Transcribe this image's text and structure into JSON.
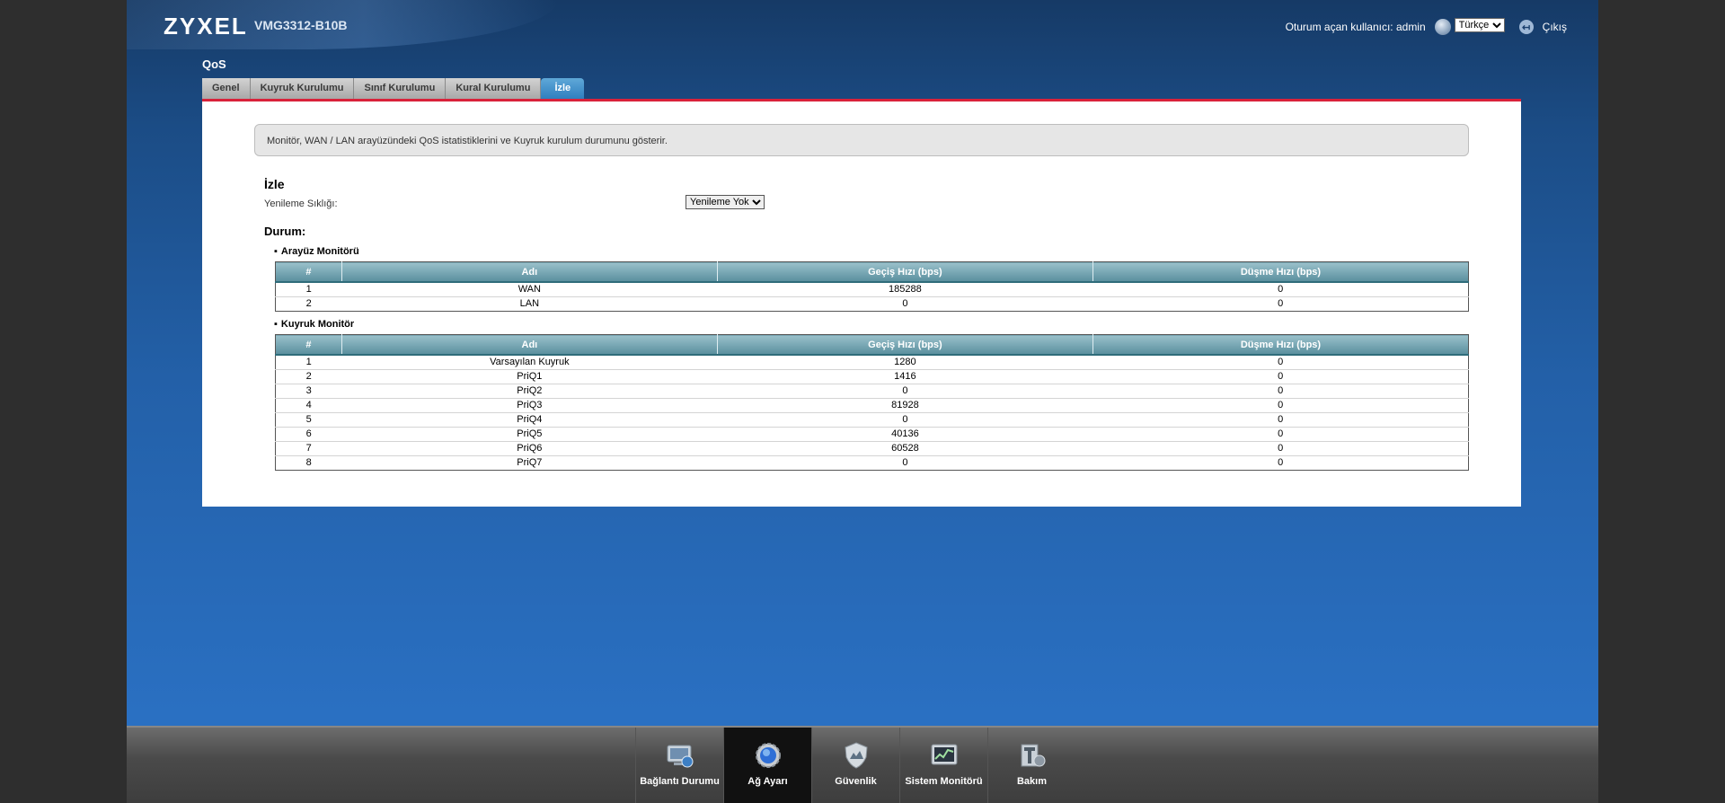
{
  "header": {
    "brand": "ZYXEL",
    "model": "VMG3312-B10B",
    "user_label": "Oturum açan kullanıcı: admin",
    "language": "Türkçe",
    "logout_label": "Çıkış"
  },
  "page": {
    "title": "QoS",
    "tabs": [
      {
        "label": "Genel",
        "active": false
      },
      {
        "label": "Kuyruk Kurulumu",
        "active": false
      },
      {
        "label": "Sınıf Kurulumu",
        "active": false
      },
      {
        "label": "Kural Kurulumu",
        "active": false
      },
      {
        "label": "İzle",
        "active": true
      }
    ]
  },
  "content": {
    "info": "Monitör, WAN / LAN arayüzündeki QoS istatistiklerini ve Kuyruk kurulum durumunu gösterir.",
    "section_title": "İzle",
    "refresh_label": "Yenileme Sıklığı:",
    "refresh_value": "Yenileme Yok",
    "status_title": "Durum:",
    "interface_monitor": {
      "title": "Arayüz Monitörü",
      "columns": [
        "#",
        "Adı",
        "Geçiş Hızı (bps)",
        "Düşme Hızı (bps)"
      ],
      "rows": [
        [
          "1",
          "WAN",
          "185288",
          "0"
        ],
        [
          "2",
          "LAN",
          "0",
          "0"
        ]
      ]
    },
    "queue_monitor": {
      "title": "Kuyruk Monitör",
      "columns": [
        "#",
        "Adı",
        "Geçiş Hızı (bps)",
        "Düşme Hızı (bps)"
      ],
      "rows": [
        [
          "1",
          "Varsayılan Kuyruk",
          "1280",
          "0"
        ],
        [
          "2",
          "PriQ1",
          "1416",
          "0"
        ],
        [
          "3",
          "PriQ2",
          "0",
          "0"
        ],
        [
          "4",
          "PriQ3",
          "81928",
          "0"
        ],
        [
          "5",
          "PriQ4",
          "0",
          "0"
        ],
        [
          "6",
          "PriQ5",
          "40136",
          "0"
        ],
        [
          "7",
          "PriQ6",
          "60528",
          "0"
        ],
        [
          "8",
          "PriQ7",
          "0",
          "0"
        ]
      ]
    }
  },
  "nav": [
    {
      "label": "Bağlantı Durumu",
      "icon": "connection-status-icon",
      "active": false
    },
    {
      "label": "Ağ Ayarı",
      "icon": "network-settings-icon",
      "active": true
    },
    {
      "label": "Güvenlik",
      "icon": "security-shield-icon",
      "active": false
    },
    {
      "label": "Sistem Monitörü",
      "icon": "system-monitor-icon",
      "active": false
    },
    {
      "label": "Bakım",
      "icon": "maintenance-icon",
      "active": false
    }
  ]
}
